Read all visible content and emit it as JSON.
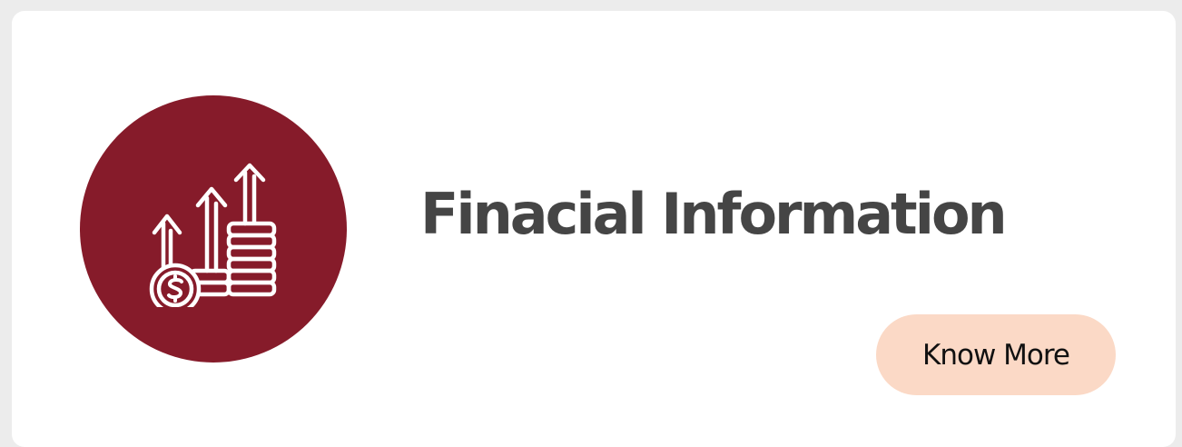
{
  "card": {
    "title": "Finacial Information",
    "cta_label": "Know More",
    "icon": "rising-coins-dollar-icon"
  },
  "colors": {
    "icon_circle": "#861b2a",
    "title_text": "#454545",
    "cta_background": "#fbd9c6"
  }
}
